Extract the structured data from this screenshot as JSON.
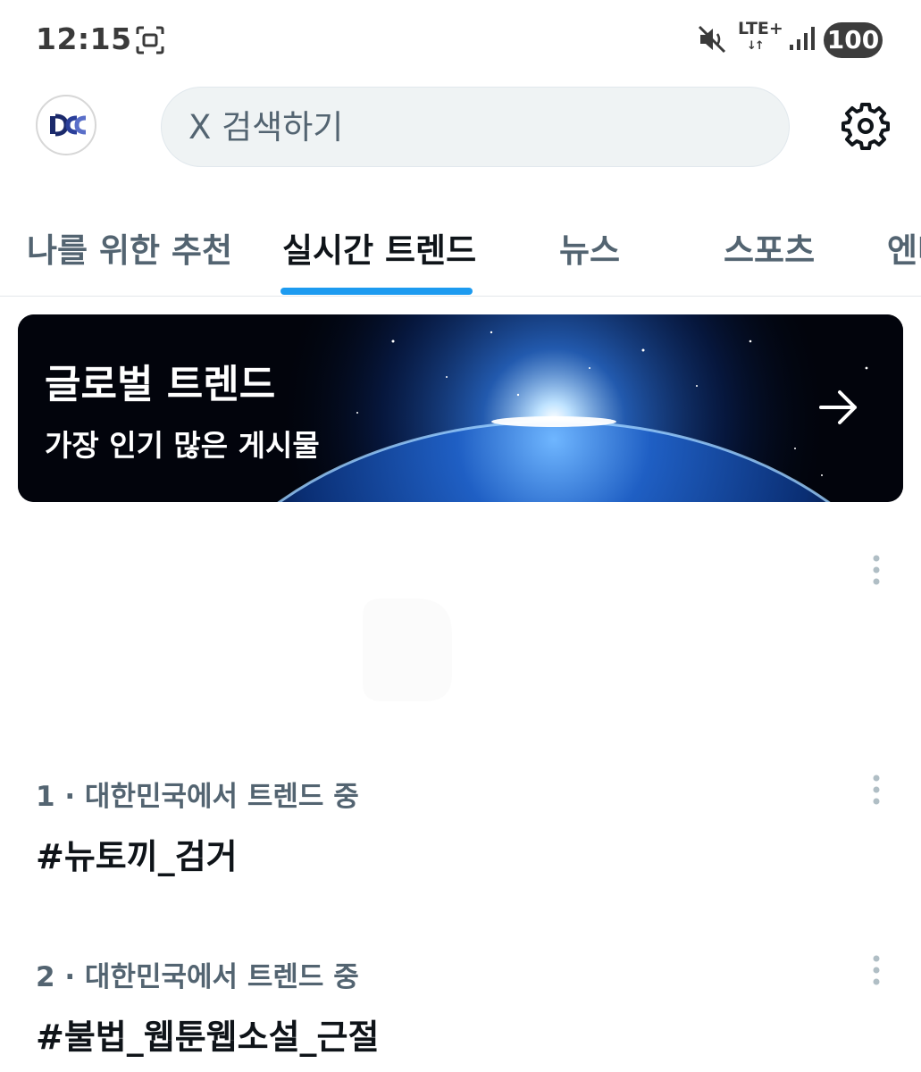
{
  "status_bar": {
    "time": "12:15",
    "network": "LTE+",
    "battery": "100"
  },
  "header": {
    "search_placeholder": "X 검색하기",
    "avatar_icon": "profile-logo-icon",
    "settings_icon": "gear-icon"
  },
  "tabs": [
    {
      "label": "나를 위한 추천",
      "active": false
    },
    {
      "label": "실시간 트렌드",
      "active": true
    },
    {
      "label": "뉴스",
      "active": false
    },
    {
      "label": "스포츠",
      "active": false
    },
    {
      "label": "엔터",
      "active": false
    }
  ],
  "banner": {
    "title": "글로벌 트렌드",
    "subtitle": "가장 인기 많은 게시물"
  },
  "trends": [
    {
      "meta": "1 · 대한민국에서 트렌드 중",
      "name": "#뉴토끼_검거"
    },
    {
      "meta": "2 · 대한민국에서 트렌드 중",
      "name": "#불법_웹툰웹소설_근절"
    }
  ],
  "colors": {
    "accent": "#1d9bf0",
    "text_primary": "#0f1419",
    "text_secondary": "#536471"
  }
}
